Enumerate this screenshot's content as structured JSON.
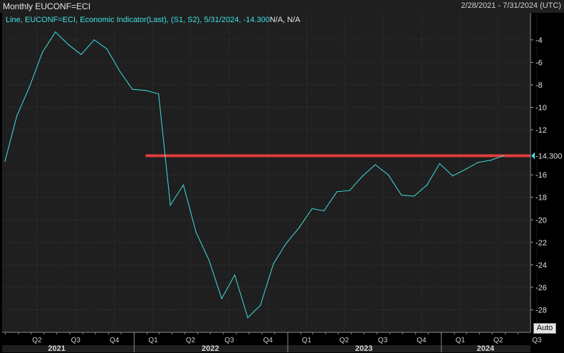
{
  "header": {
    "title": "Monthly EUCONF=ECI",
    "date_range": "2/28/2021 - 7/31/2024 (UTC)"
  },
  "legend": {
    "text": "Line, EUCONF=ECI, Economic Indicator(Last), (S1, S2), 5/31/2024, -14.300",
    "suffix": "N/A, N/A"
  },
  "auto_button": "Auto",
  "colors": {
    "background": "#1f1f1f",
    "line": "#40e0e0",
    "reference_line": "#e03c3c",
    "last_value_badge": "#40e0e0"
  },
  "chart_data": {
    "type": "line",
    "series": [
      {
        "x": [
          "2021-02",
          "2021-03",
          "2021-04",
          "2021-05",
          "2021-06",
          "2021-07",
          "2021-08",
          "2021-09",
          "2021-10",
          "2021-11",
          "2021-12",
          "2022-01",
          "2022-02",
          "2022-03",
          "2022-04",
          "2022-05",
          "2022-06",
          "2022-07",
          "2022-08",
          "2022-09",
          "2022-10",
          "2022-11",
          "2022-12",
          "2023-01",
          "2023-02",
          "2023-03",
          "2023-04",
          "2023-05",
          "2023-06",
          "2023-07",
          "2023-08",
          "2023-09",
          "2023-10",
          "2023-11",
          "2023-12",
          "2024-01",
          "2024-02",
          "2024-03",
          "2024-04",
          "2024-05"
        ],
        "values": [
          -14.8,
          -10.8,
          -8.1,
          -5.1,
          -3.3,
          -4.4,
          -5.3,
          -4.0,
          -4.8,
          -6.8,
          -8.4,
          -8.5,
          -8.8,
          -18.7,
          -16.9,
          -21.1,
          -23.6,
          -27.0,
          -24.9,
          -28.7,
          -27.6,
          -23.9,
          -22.1,
          -20.7,
          -19.0,
          -19.2,
          -17.5,
          -17.4,
          -16.1,
          -15.1,
          -16.0,
          -17.8,
          -17.9,
          -16.9,
          -15.0,
          -16.1,
          -15.5,
          -14.9,
          -14.7,
          -14.3
        ]
      }
    ],
    "horizontal_line": {
      "value": -14.3,
      "label": "-14.300",
      "from": "2022-01"
    },
    "y_ticks": [
      -4,
      -6,
      -8,
      -10,
      -12,
      -16,
      -18,
      -20,
      -22,
      -24,
      -26,
      -28
    ],
    "ylim": [
      -30.0,
      -1.6
    ],
    "x_quarter_labels": [
      {
        "label": "Q2",
        "date": "2021-05-15"
      },
      {
        "label": "Q3",
        "date": "2021-08-15"
      },
      {
        "label": "Q4",
        "date": "2021-11-15"
      },
      {
        "label": "Q1",
        "date": "2022-02-15"
      },
      {
        "label": "Q2",
        "date": "2022-05-15"
      },
      {
        "label": "Q3",
        "date": "2022-08-15"
      },
      {
        "label": "Q4",
        "date": "2022-11-15"
      },
      {
        "label": "Q1",
        "date": "2023-02-15"
      },
      {
        "label": "Q2",
        "date": "2023-05-15"
      },
      {
        "label": "Q3",
        "date": "2023-08-15"
      },
      {
        "label": "Q4",
        "date": "2023-11-15"
      },
      {
        "label": "Q1",
        "date": "2024-02-15"
      },
      {
        "label": "Q2",
        "date": "2024-05-15"
      },
      {
        "label": "Q3",
        "date": "2024-08-15"
      }
    ],
    "x_year_labels": [
      {
        "label": "2021",
        "date": "2021-07-01"
      },
      {
        "label": "2022",
        "date": "2022-07-01"
      },
      {
        "label": "2023",
        "date": "2023-07-01"
      },
      {
        "label": "2024",
        "date": "2024-04-15"
      }
    ],
    "x_year_boundaries": [
      "2022-01-01",
      "2023-01-01",
      "2024-01-01"
    ],
    "xlim": [
      "2021-02-28",
      "2024-07-31"
    ],
    "grid": true
  }
}
